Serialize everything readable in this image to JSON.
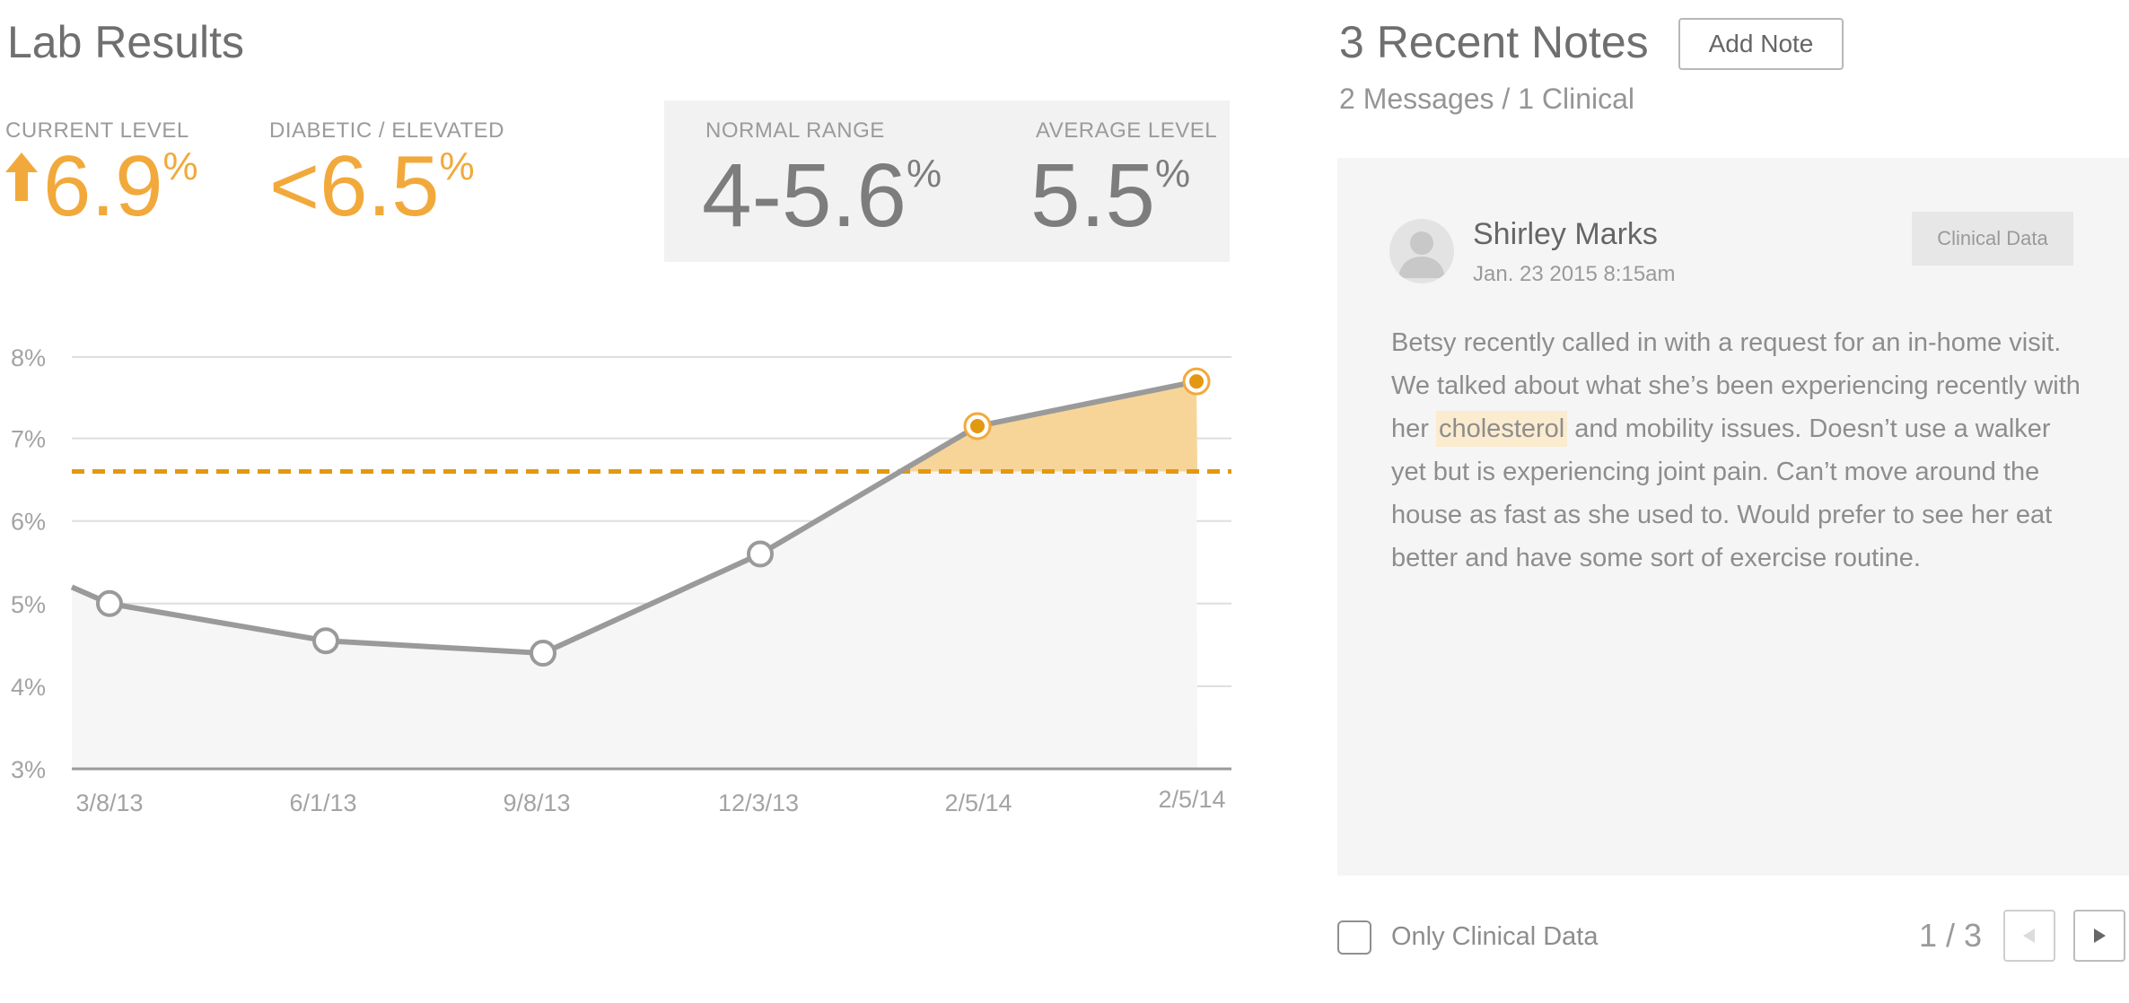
{
  "lab": {
    "title": "Lab Results",
    "current_level_label": "CURRENT LEVEL",
    "current_level_value": "6.9",
    "current_level_unit": "%",
    "diabetic_label": "DIABETIC / ELEVATED",
    "diabetic_value": "<6.5",
    "diabetic_unit": "%",
    "normal_range_label": "NORMAL RANGE",
    "normal_range_value": "4-5.6",
    "normal_range_unit": "%",
    "average_label": "AVERAGE LEVEL",
    "average_value": "5.5",
    "average_unit": "%"
  },
  "colors": {
    "accent": "#f2a93b",
    "accent_dark": "#e39812",
    "line": "#9a9a9a",
    "area": "#f6f6f6",
    "highlight_area": "#f7d394"
  },
  "chart_data": {
    "type": "line",
    "categories": [
      "3/8/13",
      "6/1/13",
      "9/8/13",
      "12/3/13",
      "2/5/14",
      "2/5/14"
    ],
    "values": [
      5.0,
      4.55,
      4.4,
      5.6,
      7.15,
      7.7
    ],
    "start_value": 5.2,
    "threshold": 6.6,
    "y_ticks": [
      "8%",
      "7%",
      "6%",
      "5%",
      "4%",
      "3%"
    ],
    "y_tick_values": [
      8,
      7,
      6,
      5,
      4,
      3
    ],
    "ylim": [
      3,
      8
    ],
    "grid": true
  },
  "notes": {
    "title": "3 Recent Notes",
    "add_button": "Add Note",
    "subtitle": "2 Messages / 1 Clinical",
    "author": "Shirley Marks",
    "timestamp": "Jan. 23 2015 8:15am",
    "badge": "Clinical Data",
    "body_before": "Betsy recently called in with a request for an in-home visit. We talked about what she’s been experiencing recently with her ",
    "body_highlight": "cholesterol",
    "body_after": " and mobility issues. Doesn’t use a walker yet but is experiencing joint pain. Can’t move around the house as fast as she used to. Would prefer to see her eat better and have some sort of exercise routine.",
    "filter_label": "Only Clinical Data",
    "pager": "1 / 3"
  },
  "icons": {
    "up_arrow": "arrow-up-icon",
    "avatar": "user-avatar-icon",
    "prev": "triangle-left-icon",
    "next": "triangle-right-icon"
  }
}
